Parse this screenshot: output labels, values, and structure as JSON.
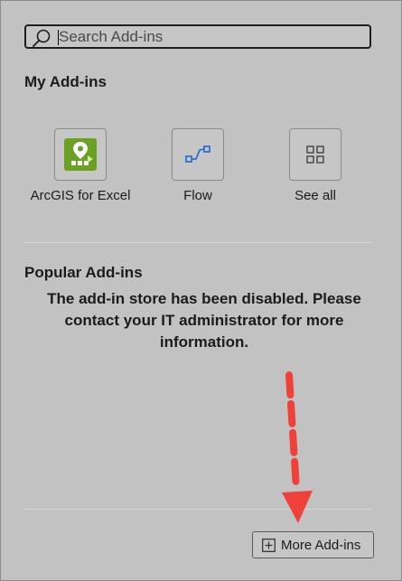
{
  "search": {
    "placeholder": "Search Add-ins",
    "value": ""
  },
  "my_addins": {
    "title": "My Add-ins",
    "items": [
      {
        "label": "ArcGIS for Excel",
        "icon": "arcgis-map-pin-icon"
      },
      {
        "label": "Flow",
        "icon": "flow-icon"
      },
      {
        "label": "See all",
        "icon": "grid-icon"
      }
    ]
  },
  "popular_addins": {
    "title": "Popular Add-ins",
    "message": "The add-in store has been disabled. Please contact your IT administrator for more information."
  },
  "footer": {
    "more_label": "More Add-ins"
  },
  "colors": {
    "background": "#c2c2c2",
    "arcgis_green": "#6aa121",
    "flow_blue": "#2f6fd1",
    "annotation_red": "#f0403a"
  }
}
